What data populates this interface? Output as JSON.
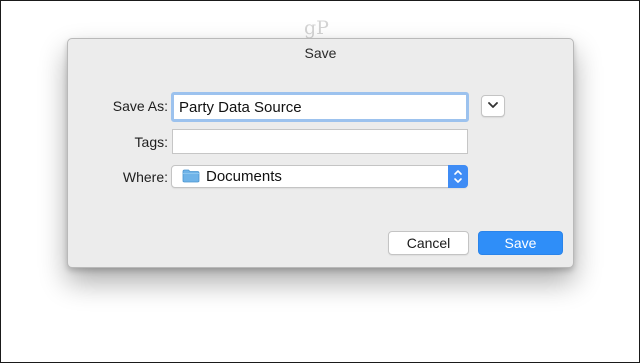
{
  "watermark": "gP",
  "dialog": {
    "title": "Save",
    "save_as": {
      "label": "Save As:",
      "value": "Party Data Source"
    },
    "tags": {
      "label": "Tags:",
      "value": ""
    },
    "where": {
      "label": "Where:",
      "value": "Documents",
      "icon": "folder-icon"
    },
    "buttons": {
      "cancel": "Cancel",
      "save": "Save"
    }
  },
  "colors": {
    "accent": "#2f8ef8",
    "focus_ring": "#9cc2ee",
    "folder": "#6fb3e8",
    "dialog_bg": "#ececec"
  }
}
